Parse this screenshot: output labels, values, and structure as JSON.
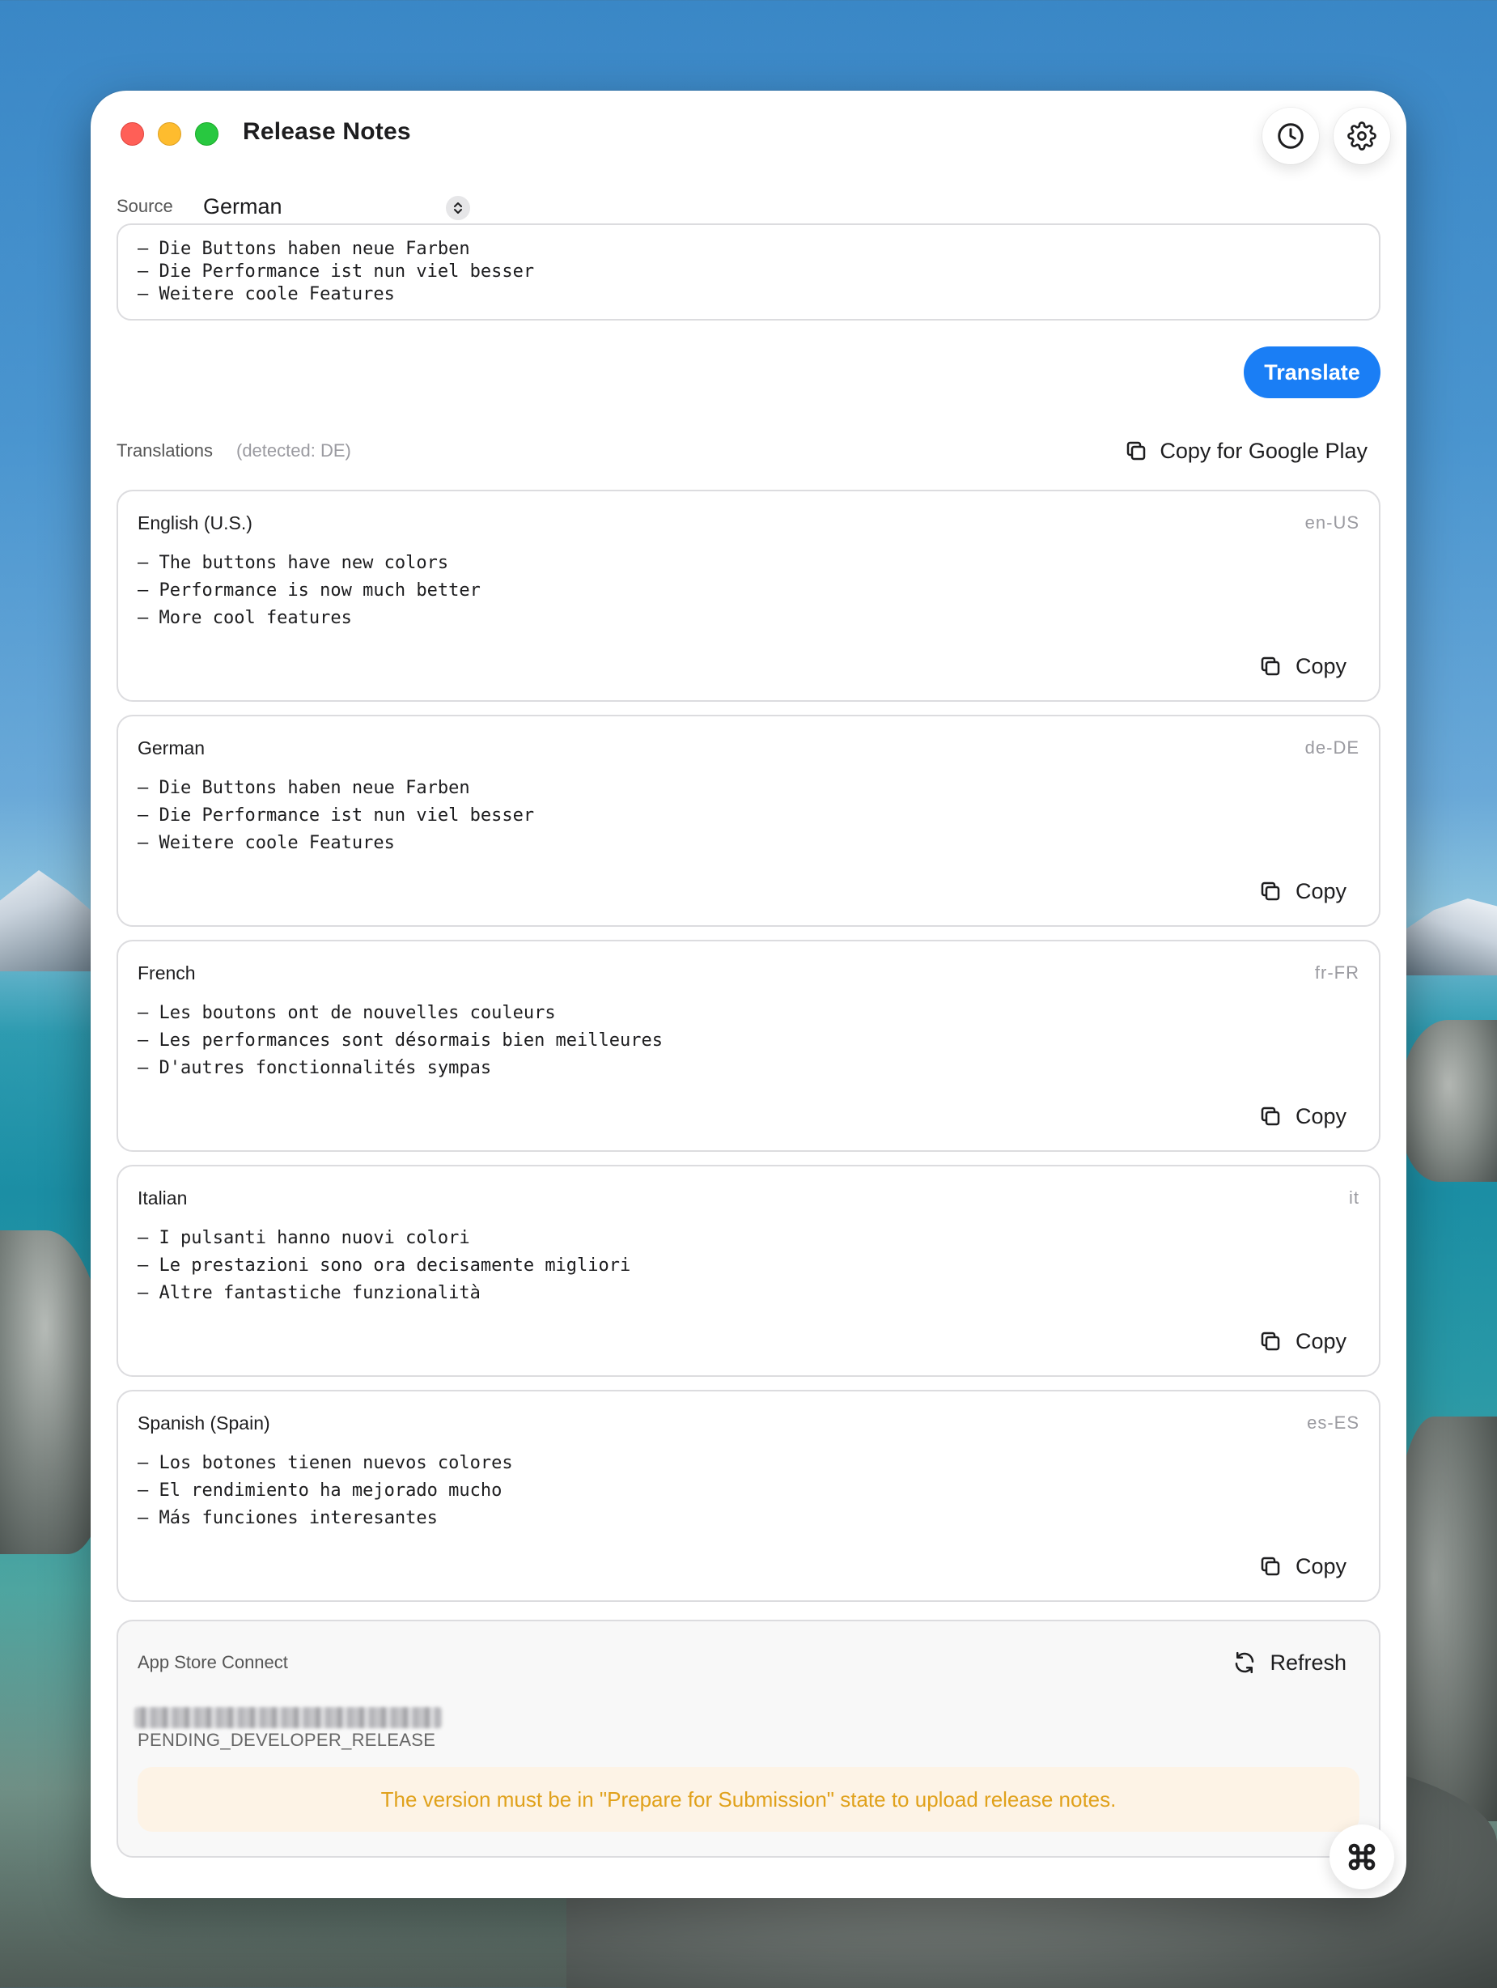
{
  "window": {
    "title": "Release Notes"
  },
  "toolbar": {
    "history_icon": "clock-icon",
    "settings_icon": "gear-icon"
  },
  "source": {
    "label": "Source",
    "language": "German",
    "text": "– Die Buttons haben neue Farben\n– Die Performance ist nun viel besser\n– Weitere coole Features"
  },
  "translate_button": "Translate",
  "translations": {
    "label": "Translations",
    "detected": "(detected: DE)",
    "copy_google_play": "Copy for Google Play",
    "copy_label": "Copy",
    "items": [
      {
        "language": "English (U.S.)",
        "code": "en-US",
        "text": "– The buttons have new colors\n– Performance is now much better\n– More cool features"
      },
      {
        "language": "German",
        "code": "de-DE",
        "text": "– Die Buttons haben neue Farben\n– Die Performance ist nun viel besser\n– Weitere coole Features"
      },
      {
        "language": "French",
        "code": "fr-FR",
        "text": "– Les boutons ont de nouvelles couleurs\n– Les performances sont désormais bien meilleures\n– D'autres fonctionnalités sympas"
      },
      {
        "language": "Italian",
        "code": "it",
        "text": "– I pulsanti hanno nuovi colori\n– Le prestazioni sono ora decisamente migliori\n– Altre fantastiche funzionalità"
      },
      {
        "language": "Spanish (Spain)",
        "code": "es-ES",
        "text": "– Los botones tienen nuevos colores\n– El rendimiento ha mejorado mucho\n– Más funciones interesantes"
      }
    ]
  },
  "app_store_connect": {
    "title": "App Store Connect",
    "refresh_label": "Refresh",
    "status": "PENDING_DEVELOPER_RELEASE",
    "warning": "The version must be in \"Prepare for Submission\" state to upload release notes."
  },
  "colors": {
    "accent": "#1a7ef5",
    "warning_text": "#e0a11b",
    "warning_bg": "#fdf3e6"
  }
}
